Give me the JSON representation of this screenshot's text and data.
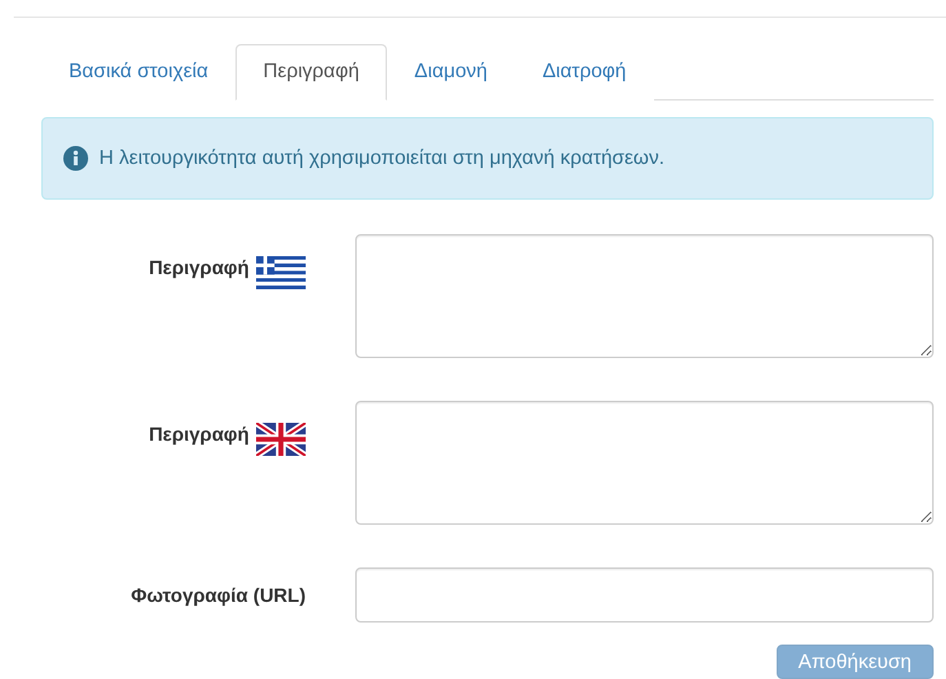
{
  "tabs": [
    {
      "label": "Βασικά στοιχεία",
      "selected": false
    },
    {
      "label": "Περιγραφή",
      "selected": true
    },
    {
      "label": "Διαμονή",
      "selected": false
    },
    {
      "label": "Διατροφή",
      "selected": false
    }
  ],
  "alert": {
    "text": "Η λειτουργικότητα αυτή χρησιμοποιείται στη μηχανή κρατήσεων."
  },
  "fields": [
    {
      "label": "Περιγραφή",
      "flag": {
        "kind": "gr"
      },
      "kind": "textarea"
    },
    {
      "label": "Περιγραφή",
      "flag": {
        "kind": "gb"
      },
      "kind": "textarea"
    },
    {
      "label": "Φωτογραφία (URL)",
      "kind": "input"
    }
  ],
  "save_button": {
    "label": "Αποθήκευση",
    "disabled": true
  }
}
